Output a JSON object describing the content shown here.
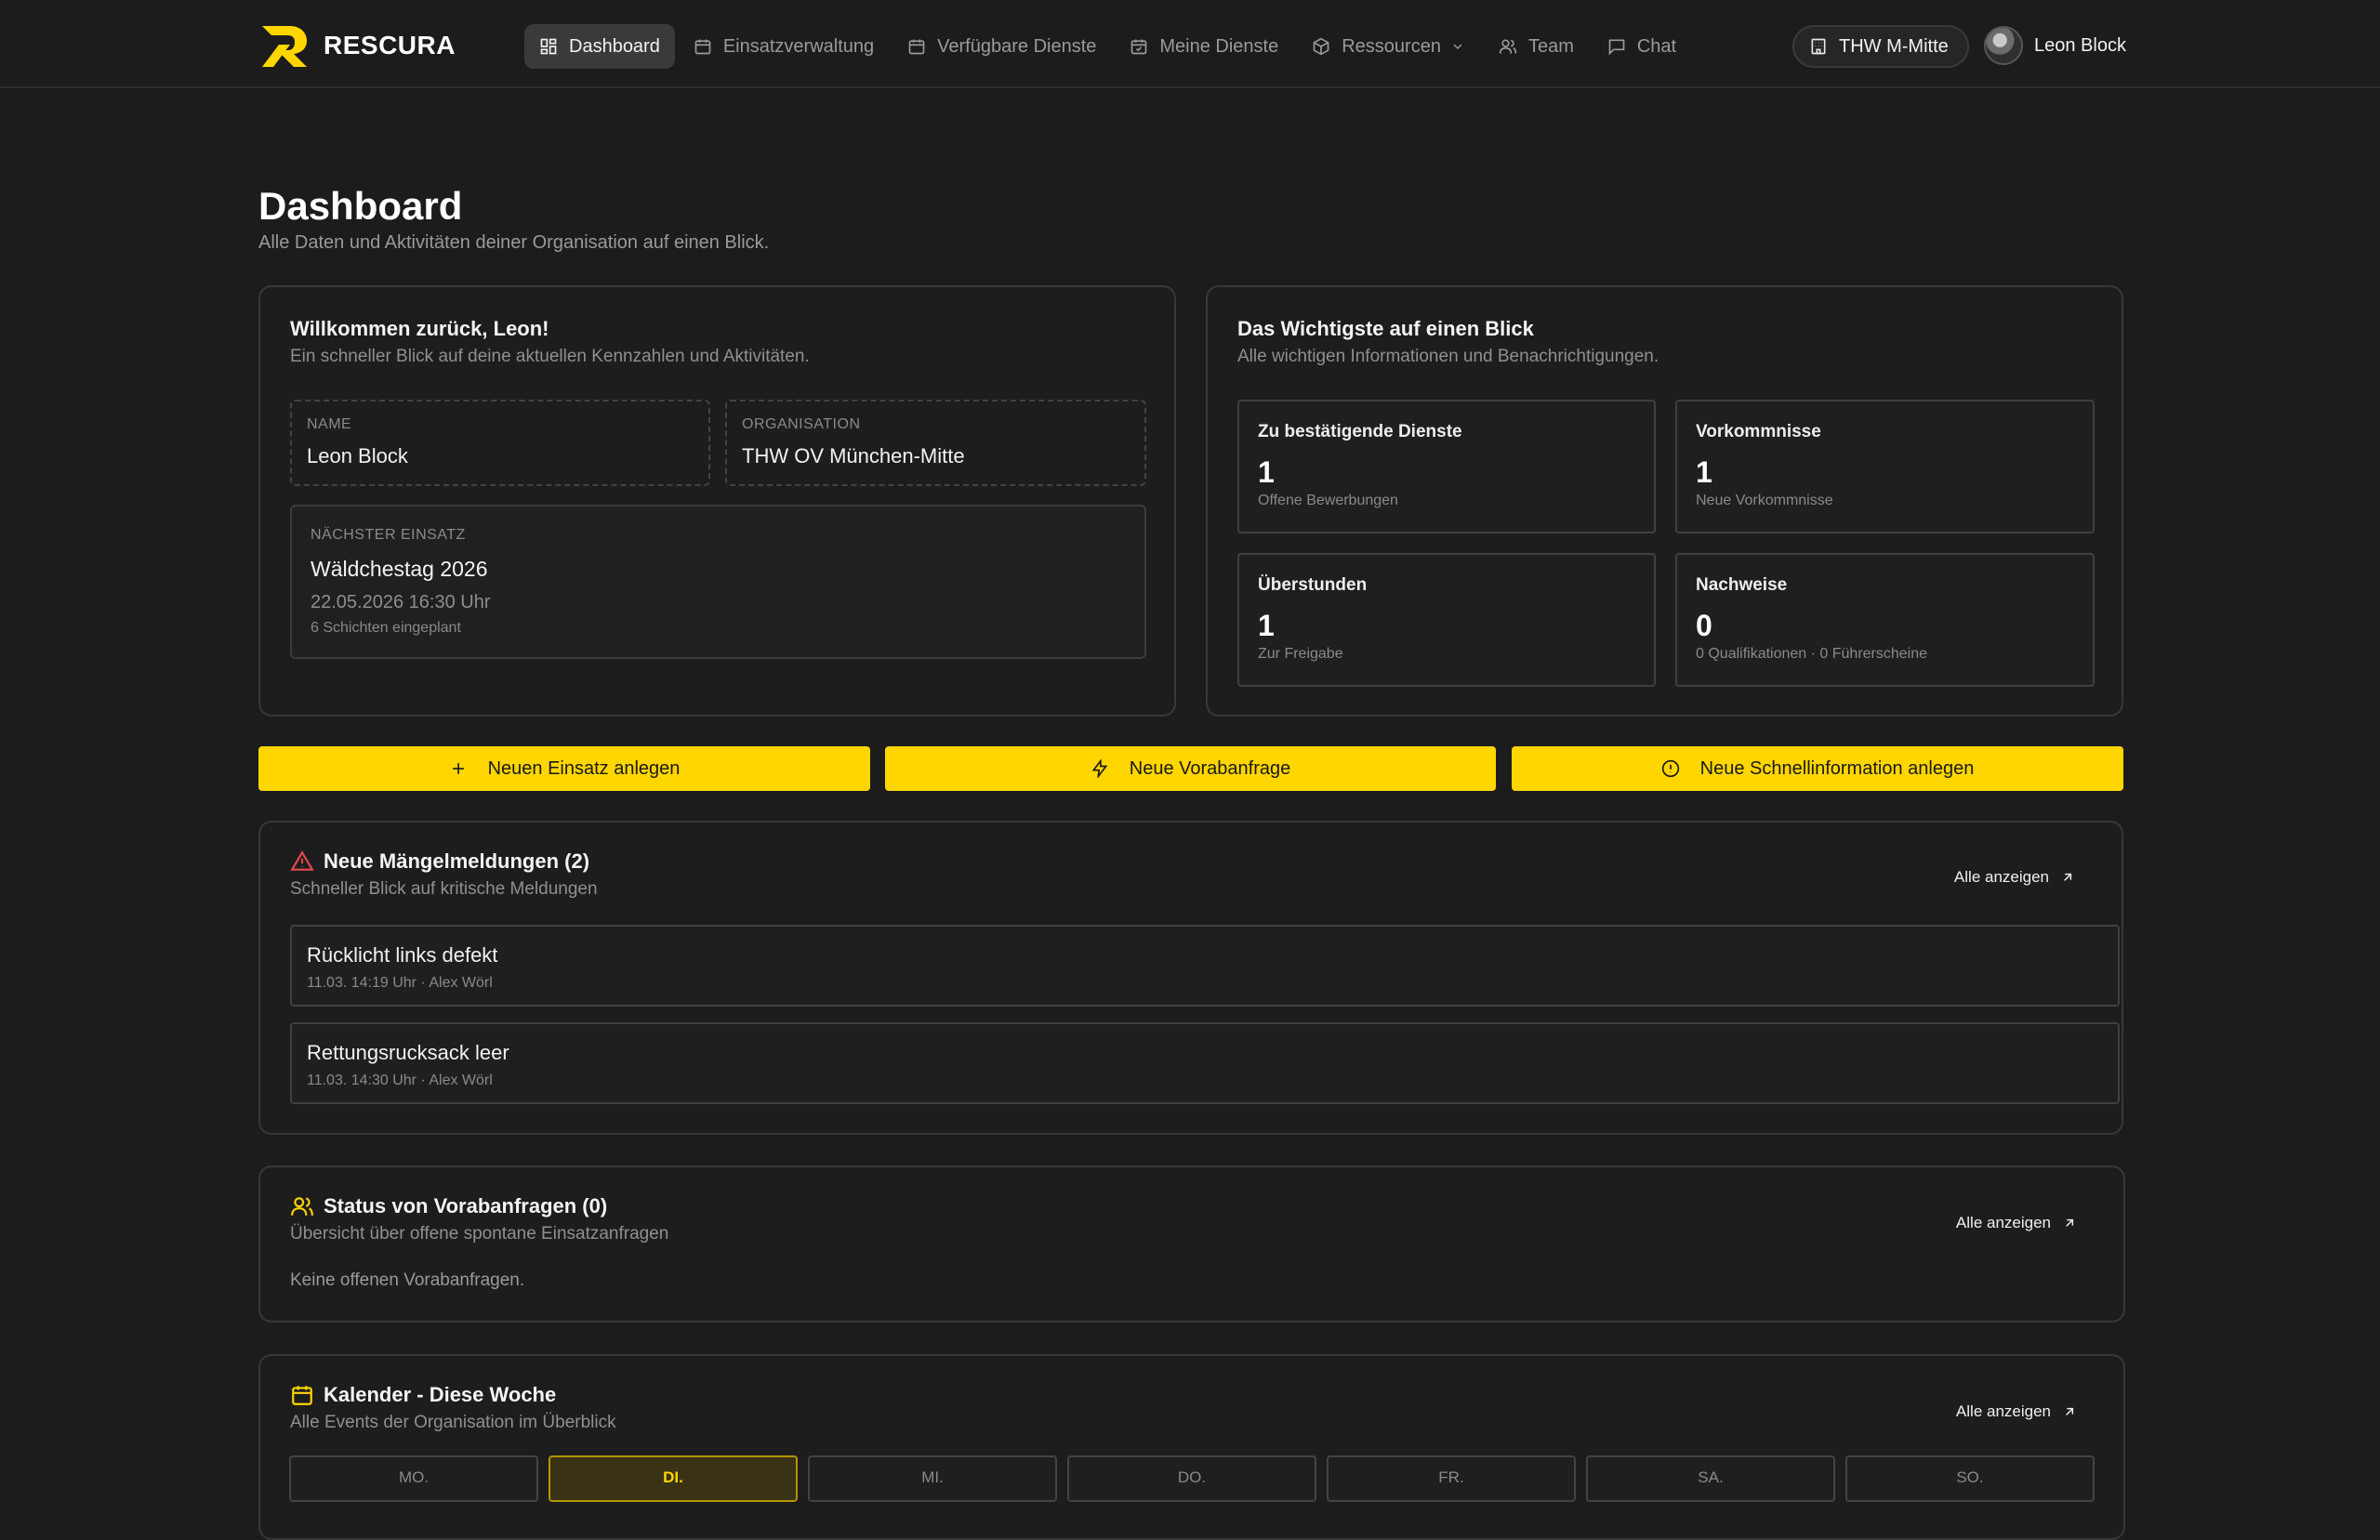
{
  "app": {
    "name": "RESCURA"
  },
  "nav": {
    "items": [
      {
        "label": "Dashboard",
        "icon": "dashboard-icon",
        "active": true
      },
      {
        "label": "Einsatzverwaltung",
        "icon": "calendar-icon"
      },
      {
        "label": "Verfügbare Dienste",
        "icon": "calendar-icon"
      },
      {
        "label": "Meine Dienste",
        "icon": "calendar-check-icon"
      },
      {
        "label": "Ressourcen",
        "icon": "package-icon",
        "dropdown": true
      },
      {
        "label": "Team",
        "icon": "users-icon"
      },
      {
        "label": "Chat",
        "icon": "chat-icon"
      }
    ],
    "org_pill": "THW M-Mitte",
    "user_name": "Leon Block"
  },
  "page": {
    "title": "Dashboard",
    "subtitle": "Alle Daten und Aktivitäten deiner Organisation auf einen Blick."
  },
  "welcome": {
    "title": "Willkommen zurück, Leon!",
    "subtitle": "Ein schneller Blick auf deine aktuellen Kennzahlen und Aktivitäten.",
    "name_label": "NAME",
    "name_value": "Leon Block",
    "org_label": "ORGANISATION",
    "org_value": "THW OV München-Mitte",
    "next_label": "NÄCHSTER EINSATZ",
    "next_title": "Wäldchestag 2026",
    "next_date": "22.05.2026 16:30 Uhr",
    "next_shifts": "6 Schichten eingeplant"
  },
  "overview": {
    "title": "Das Wichtigste auf einen Blick",
    "subtitle": "Alle wichtigen Informationen und Benachrichtigungen.",
    "stats": [
      {
        "title": "Zu bestätigende Dienste",
        "value": "1",
        "sub": "Offene Bewerbungen"
      },
      {
        "title": "Vorkommnisse",
        "value": "1",
        "sub": "Neue Vorkommnisse"
      },
      {
        "title": "Überstunden",
        "value": "1",
        "sub": "Zur Freigabe"
      },
      {
        "title": "Nachweise",
        "value": "0",
        "sub": "0 Qualifikationen · 0 Führerscheine"
      }
    ]
  },
  "actions": {
    "new_mission": "Neuen Einsatz anlegen",
    "new_request": "Neue Vorabanfrage",
    "new_info": "Neue Schnellinformation anlegen"
  },
  "defects": {
    "title": "Neue Mängelmeldungen (2)",
    "subtitle": "Schneller Blick auf kritische Meldungen",
    "show_all": "Alle anzeigen",
    "items": [
      {
        "title": "Rücklicht links defekt",
        "meta": "11.03. 14:19 Uhr · Alex Wörl"
      },
      {
        "title": "Rettungsrucksack leer",
        "meta": "11.03. 14:30 Uhr · Alex Wörl"
      }
    ]
  },
  "requests": {
    "title": "Status von Vorabanfragen (0)",
    "subtitle": "Übersicht über offene spontane Einsatzanfragen",
    "show_all": "Alle anzeigen",
    "empty": "Keine offenen Vorabanfragen."
  },
  "calendar": {
    "title": "Kalender - Diese Woche",
    "subtitle": "Alle Events der Organisation im Überblick",
    "show_all": "Alle anzeigen",
    "days": [
      "MO.",
      "DI.",
      "MI.",
      "DO.",
      "FR.",
      "SA.",
      "SO."
    ],
    "today_index": 1
  },
  "colors": {
    "accent": "#ffd600",
    "danger": "#e5484d",
    "background": "#1c1c1c"
  }
}
